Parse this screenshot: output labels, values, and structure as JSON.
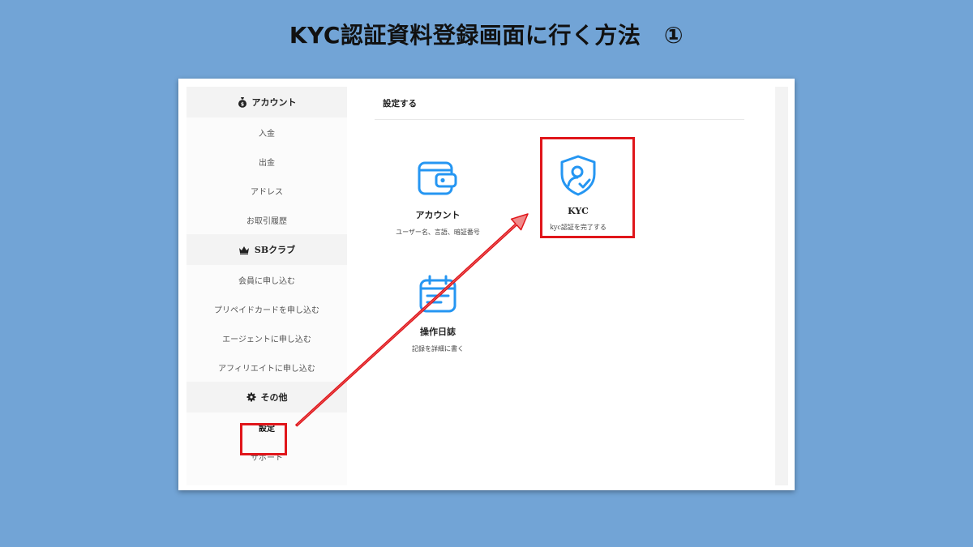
{
  "slide": {
    "title": "KYC認証資料登録画面に行く方法　①"
  },
  "sidebar": {
    "sections": [
      {
        "icon": "money-bag-icon",
        "title": "アカウント",
        "items": [
          "入金",
          "出金",
          "アドレス",
          "お取引履歴"
        ]
      },
      {
        "icon": "crown-icon",
        "title": "SBクラブ",
        "items": [
          "会員に申し込む",
          "プリペイドカードを申し込む",
          "エージェントに申し込む",
          "アフィリエイトに申し込む"
        ]
      },
      {
        "icon": "gear-icon",
        "title": "その他",
        "items": [
          "設定",
          "サポート"
        ]
      }
    ]
  },
  "main": {
    "title": "設定する",
    "cards": [
      {
        "icon": "wallet-icon",
        "title": "アカウント",
        "subtitle": "ユーザー名、言語、暗証番号"
      },
      {
        "icon": "shield-user-icon",
        "title": "KYC",
        "subtitle": "kyc認証を完了する"
      },
      {
        "icon": "calendar-icon",
        "title": "操作日誌",
        "subtitle": "記録を詳細に書く"
      }
    ]
  },
  "colors": {
    "background": "#72a4d6",
    "accent": "#2596f2",
    "highlight": "#e0161b",
    "arrow": "#f08a8a"
  }
}
